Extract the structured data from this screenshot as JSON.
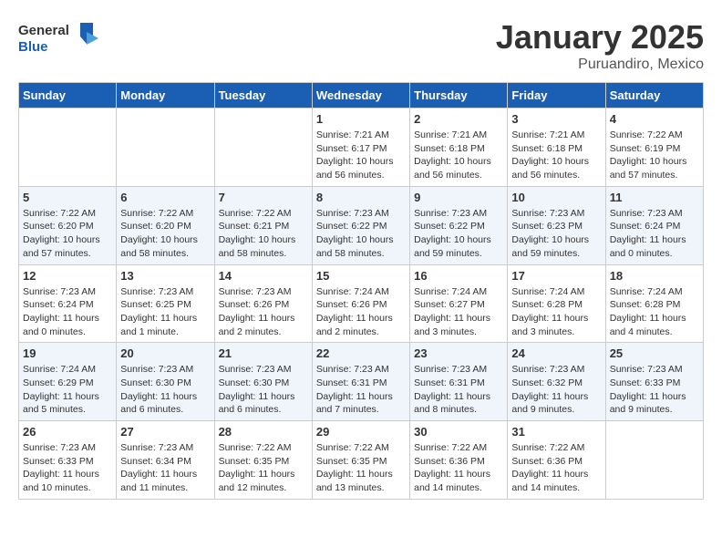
{
  "header": {
    "logo_general": "General",
    "logo_blue": "Blue",
    "month": "January 2025",
    "location": "Puruandiro, Mexico"
  },
  "days_of_week": [
    "Sunday",
    "Monday",
    "Tuesday",
    "Wednesday",
    "Thursday",
    "Friday",
    "Saturday"
  ],
  "weeks": [
    [
      {
        "day": "",
        "sunrise": "",
        "sunset": "",
        "daylight": ""
      },
      {
        "day": "",
        "sunrise": "",
        "sunset": "",
        "daylight": ""
      },
      {
        "day": "",
        "sunrise": "",
        "sunset": "",
        "daylight": ""
      },
      {
        "day": "1",
        "sunrise": "Sunrise: 7:21 AM",
        "sunset": "Sunset: 6:17 PM",
        "daylight": "Daylight: 10 hours and 56 minutes."
      },
      {
        "day": "2",
        "sunrise": "Sunrise: 7:21 AM",
        "sunset": "Sunset: 6:18 PM",
        "daylight": "Daylight: 10 hours and 56 minutes."
      },
      {
        "day": "3",
        "sunrise": "Sunrise: 7:21 AM",
        "sunset": "Sunset: 6:18 PM",
        "daylight": "Daylight: 10 hours and 56 minutes."
      },
      {
        "day": "4",
        "sunrise": "Sunrise: 7:22 AM",
        "sunset": "Sunset: 6:19 PM",
        "daylight": "Daylight: 10 hours and 57 minutes."
      }
    ],
    [
      {
        "day": "5",
        "sunrise": "Sunrise: 7:22 AM",
        "sunset": "Sunset: 6:20 PM",
        "daylight": "Daylight: 10 hours and 57 minutes."
      },
      {
        "day": "6",
        "sunrise": "Sunrise: 7:22 AM",
        "sunset": "Sunset: 6:20 PM",
        "daylight": "Daylight: 10 hours and 58 minutes."
      },
      {
        "day": "7",
        "sunrise": "Sunrise: 7:22 AM",
        "sunset": "Sunset: 6:21 PM",
        "daylight": "Daylight: 10 hours and 58 minutes."
      },
      {
        "day": "8",
        "sunrise": "Sunrise: 7:23 AM",
        "sunset": "Sunset: 6:22 PM",
        "daylight": "Daylight: 10 hours and 58 minutes."
      },
      {
        "day": "9",
        "sunrise": "Sunrise: 7:23 AM",
        "sunset": "Sunset: 6:22 PM",
        "daylight": "Daylight: 10 hours and 59 minutes."
      },
      {
        "day": "10",
        "sunrise": "Sunrise: 7:23 AM",
        "sunset": "Sunset: 6:23 PM",
        "daylight": "Daylight: 10 hours and 59 minutes."
      },
      {
        "day": "11",
        "sunrise": "Sunrise: 7:23 AM",
        "sunset": "Sunset: 6:24 PM",
        "daylight": "Daylight: 11 hours and 0 minutes."
      }
    ],
    [
      {
        "day": "12",
        "sunrise": "Sunrise: 7:23 AM",
        "sunset": "Sunset: 6:24 PM",
        "daylight": "Daylight: 11 hours and 0 minutes."
      },
      {
        "day": "13",
        "sunrise": "Sunrise: 7:23 AM",
        "sunset": "Sunset: 6:25 PM",
        "daylight": "Daylight: 11 hours and 1 minute."
      },
      {
        "day": "14",
        "sunrise": "Sunrise: 7:23 AM",
        "sunset": "Sunset: 6:26 PM",
        "daylight": "Daylight: 11 hours and 2 minutes."
      },
      {
        "day": "15",
        "sunrise": "Sunrise: 7:24 AM",
        "sunset": "Sunset: 6:26 PM",
        "daylight": "Daylight: 11 hours and 2 minutes."
      },
      {
        "day": "16",
        "sunrise": "Sunrise: 7:24 AM",
        "sunset": "Sunset: 6:27 PM",
        "daylight": "Daylight: 11 hours and 3 minutes."
      },
      {
        "day": "17",
        "sunrise": "Sunrise: 7:24 AM",
        "sunset": "Sunset: 6:28 PM",
        "daylight": "Daylight: 11 hours and 3 minutes."
      },
      {
        "day": "18",
        "sunrise": "Sunrise: 7:24 AM",
        "sunset": "Sunset: 6:28 PM",
        "daylight": "Daylight: 11 hours and 4 minutes."
      }
    ],
    [
      {
        "day": "19",
        "sunrise": "Sunrise: 7:24 AM",
        "sunset": "Sunset: 6:29 PM",
        "daylight": "Daylight: 11 hours and 5 minutes."
      },
      {
        "day": "20",
        "sunrise": "Sunrise: 7:23 AM",
        "sunset": "Sunset: 6:30 PM",
        "daylight": "Daylight: 11 hours and 6 minutes."
      },
      {
        "day": "21",
        "sunrise": "Sunrise: 7:23 AM",
        "sunset": "Sunset: 6:30 PM",
        "daylight": "Daylight: 11 hours and 6 minutes."
      },
      {
        "day": "22",
        "sunrise": "Sunrise: 7:23 AM",
        "sunset": "Sunset: 6:31 PM",
        "daylight": "Daylight: 11 hours and 7 minutes."
      },
      {
        "day": "23",
        "sunrise": "Sunrise: 7:23 AM",
        "sunset": "Sunset: 6:31 PM",
        "daylight": "Daylight: 11 hours and 8 minutes."
      },
      {
        "day": "24",
        "sunrise": "Sunrise: 7:23 AM",
        "sunset": "Sunset: 6:32 PM",
        "daylight": "Daylight: 11 hours and 9 minutes."
      },
      {
        "day": "25",
        "sunrise": "Sunrise: 7:23 AM",
        "sunset": "Sunset: 6:33 PM",
        "daylight": "Daylight: 11 hours and 9 minutes."
      }
    ],
    [
      {
        "day": "26",
        "sunrise": "Sunrise: 7:23 AM",
        "sunset": "Sunset: 6:33 PM",
        "daylight": "Daylight: 11 hours and 10 minutes."
      },
      {
        "day": "27",
        "sunrise": "Sunrise: 7:23 AM",
        "sunset": "Sunset: 6:34 PM",
        "daylight": "Daylight: 11 hours and 11 minutes."
      },
      {
        "day": "28",
        "sunrise": "Sunrise: 7:22 AM",
        "sunset": "Sunset: 6:35 PM",
        "daylight": "Daylight: 11 hours and 12 minutes."
      },
      {
        "day": "29",
        "sunrise": "Sunrise: 7:22 AM",
        "sunset": "Sunset: 6:35 PM",
        "daylight": "Daylight: 11 hours and 13 minutes."
      },
      {
        "day": "30",
        "sunrise": "Sunrise: 7:22 AM",
        "sunset": "Sunset: 6:36 PM",
        "daylight": "Daylight: 11 hours and 14 minutes."
      },
      {
        "day": "31",
        "sunrise": "Sunrise: 7:22 AM",
        "sunset": "Sunset: 6:36 PM",
        "daylight": "Daylight: 11 hours and 14 minutes."
      },
      {
        "day": "",
        "sunrise": "",
        "sunset": "",
        "daylight": ""
      }
    ]
  ]
}
